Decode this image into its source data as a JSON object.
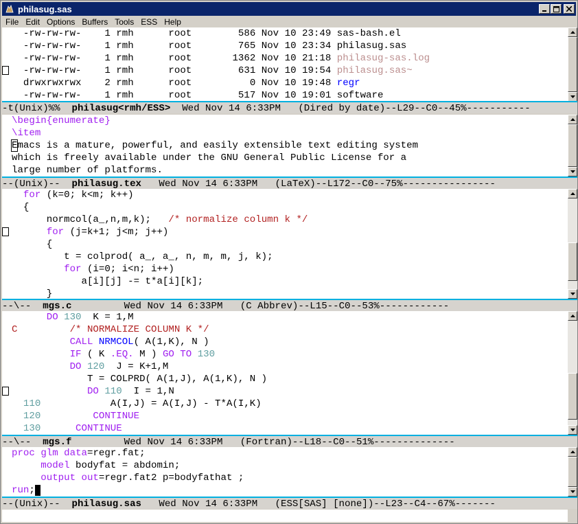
{
  "window": {
    "title": "philasug.sas",
    "icon": "emacs-gnu-icon"
  },
  "menu": [
    "File",
    "Edit",
    "Options",
    "Buffers",
    "Tools",
    "ESS",
    "Help"
  ],
  "dired": {
    "rows": [
      {
        "perm": "-rw-rw-rw-",
        "links": "1",
        "owner": "rmh",
        "group": "root",
        "size": "586",
        "mon": "Nov",
        "day": "10",
        "time": "23:49",
        "name": "sas-bash.el",
        "style": "plain",
        "mark": ""
      },
      {
        "perm": "-rw-rw-rw-",
        "links": "1",
        "owner": "rmh",
        "group": "root",
        "size": "765",
        "mon": "Nov",
        "day": "10",
        "time": "23:34",
        "name": "philasug.sas",
        "style": "plain",
        "mark": ""
      },
      {
        "perm": "-rw-rw-rw-",
        "links": "1",
        "owner": "rmh",
        "group": "root",
        "size": "1362",
        "mon": "Nov",
        "day": "10",
        "time": "21:18",
        "name": "philasug-sas.log",
        "style": "ghost",
        "mark": ""
      },
      {
        "perm": "-rw-rw-rw-",
        "links": "1",
        "owner": "rmh",
        "group": "root",
        "size": "631",
        "mon": "Nov",
        "day": "10",
        "time": "19:54",
        "name": "philasug.sas~",
        "style": "ghost",
        "mark": "box"
      },
      {
        "perm": "drwxrwxrwx",
        "links": "2",
        "owner": "rmh",
        "group": "root",
        "size": "0",
        "mon": "Nov",
        "day": "10",
        "time": "19:48",
        "name": "regr",
        "style": "dir",
        "mark": ""
      },
      {
        "perm": "-rw-rw-rw-",
        "links": "1",
        "owner": "rmh",
        "group": "root",
        "size": "517",
        "mon": "Nov",
        "day": "10",
        "time": "19:01",
        "name": "software",
        "style": "plain",
        "mark": ""
      }
    ],
    "modeline": {
      "pre": "-t(Unix)%%  ",
      "buf": "philasug<rmh/ESS>",
      "post": "  Wed Nov 14 6:33PM   (Dired by date)--L29--C0--45%-----------"
    }
  },
  "tex": {
    "lines": [
      [
        "\\begin",
        "{enumerate}"
      ],
      [
        "\\item",
        ""
      ],
      [
        "",
        "Emacs is a mature, powerful, and easily extensible text editing system"
      ],
      [
        "",
        "which is freely available under the GNU General Public License for a"
      ],
      [
        "",
        "large number of platforms."
      ]
    ],
    "modeline": {
      "pre": "--(Unix)--  ",
      "buf": "philasug.tex",
      "post": "   Wed Nov 14 6:33PM   (LaTeX)--L172--C0--75%----------------"
    }
  },
  "c": {
    "l1_kw": "for",
    " l1_rest": " (k=0; k<m; k++)",
    "l2": "{",
    "l3_code": "normcol(a_,n,m,k);",
    "l3_com": "/* normalize column k */",
    "l4_kw": "for",
    "l4_rest": " (j=k+1; j<m; j++)",
    "l5": "{",
    "l6": "t = colprod( a_, a_, n, m, m, j, k);",
    "l7_kw": "for",
    "l7_rest": " (i=0; i<n; i++)",
    "l8": "a[i][j] -= t*a[i][k];",
    "l9": "}",
    "modeline": {
      "pre": "--\\--  ",
      "buf": "mgs.c",
      "post": "         Wed Nov 14 6:33PM   (C Abbrev)--L15--C0--53%------------"
    }
  },
  "f": {
    "l1_kw": "DO",
    "l1_lbl": "130",
    "l1_rest": "  K = 1,M",
    "l2_c": "C",
    "l2_com": "/* NORMALIZE COLUMN K */",
    "l3_kw": "CALL",
    "l3_fn": "NRMCOL",
    "l3_rest": "( A(1,K), N )",
    "l4_kw": "IF",
    "l4_a": " ( K ",
    "l4_op": ".EQ.",
    "l4_b": " M ) ",
    "l4_goto": "GO TO",
    "l4_lbl": "130",
    "l5_kw": "DO",
    "l5_lbl": "120",
    "l5_rest": "  J = K+1,M",
    "l6": "T = COLPRD( A(1,J), A(1,K), N )",
    "l7_kw": "DO",
    "l7_lbl": "110",
    "l7_rest": "  I = 1,N",
    "l8_lbl": "110",
    "l8": "A(I,J) = A(I,J) - T*A(I,K)",
    "l9_lbl": "120",
    "l9": "CONTINUE",
    "l10_lbl": "130",
    "l10": "CONTINUE",
    "modeline": {
      "pre": "--\\--  ",
      "buf": "mgs.f",
      "post": "         Wed Nov 14 6:33PM   (Fortran)--L18--C0--51%--------------"
    }
  },
  "sas": {
    "l1_kw": "proc",
    "l1_kw2": "glm",
    "l1_kw3": "data",
    "l1_rest": "=regr.fat;",
    "l2_kw": "model",
    "l2_rest": " bodyfat = abdomin;",
    "l3_kw": "output",
    "l3_kw2": "out",
    "l3_rest": "=regr.fat2 p=bodyfathat ;",
    "l4_kw": "run",
    ";": ";",
    "modeline": {
      "pre": "--(Unix)--  ",
      "buf": "philasug.sas",
      "post": "   Wed Nov 14 6:33PM   (ESS[SAS] [none])--L23--C4--67%-------"
    }
  },
  "colors": {
    "titlebar": "#0a246a",
    "modeline": "#d6d3ce",
    "modeline_border": "#00b0e0",
    "keyword": "#a020f0",
    "comment": "#b22222",
    "ghost": "#bc8f8f",
    "label": "#5f9ea0"
  }
}
